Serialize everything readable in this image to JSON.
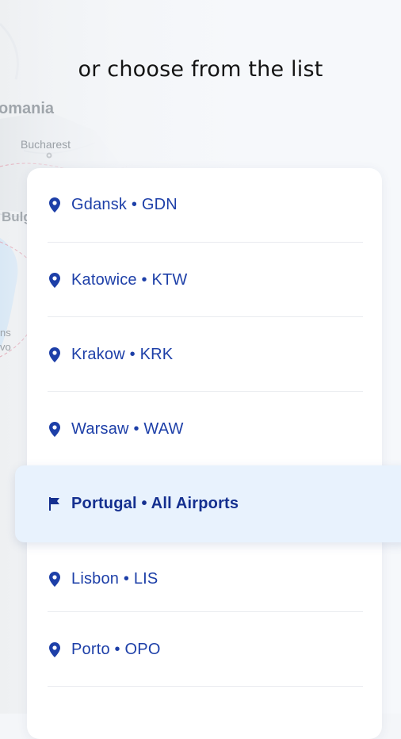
{
  "map": {
    "labels": [
      "omania",
      "Bucharest",
      "Bulg",
      "ns",
      "vo"
    ]
  },
  "header": {
    "title": "or choose from the list"
  },
  "airports": [
    {
      "label": "Gdansk • GDN",
      "icon": "location-pin-icon"
    },
    {
      "label": "Katowice • KTW",
      "icon": "location-pin-icon"
    },
    {
      "label": "Krakow • KRK",
      "icon": "location-pin-icon"
    },
    {
      "label": "Warsaw • WAW",
      "icon": "location-pin-icon"
    },
    {
      "label": "Portugal • All Airports",
      "icon": "flag-icon",
      "selected": true
    },
    {
      "label": "Lisbon • LIS",
      "icon": "location-pin-icon"
    },
    {
      "label": "Porto • OPO",
      "icon": "location-pin-icon"
    }
  ],
  "colors": {
    "accent": "#1d3fa8",
    "selected_bg": "#e8f2fd",
    "card_bg": "#ffffff"
  }
}
